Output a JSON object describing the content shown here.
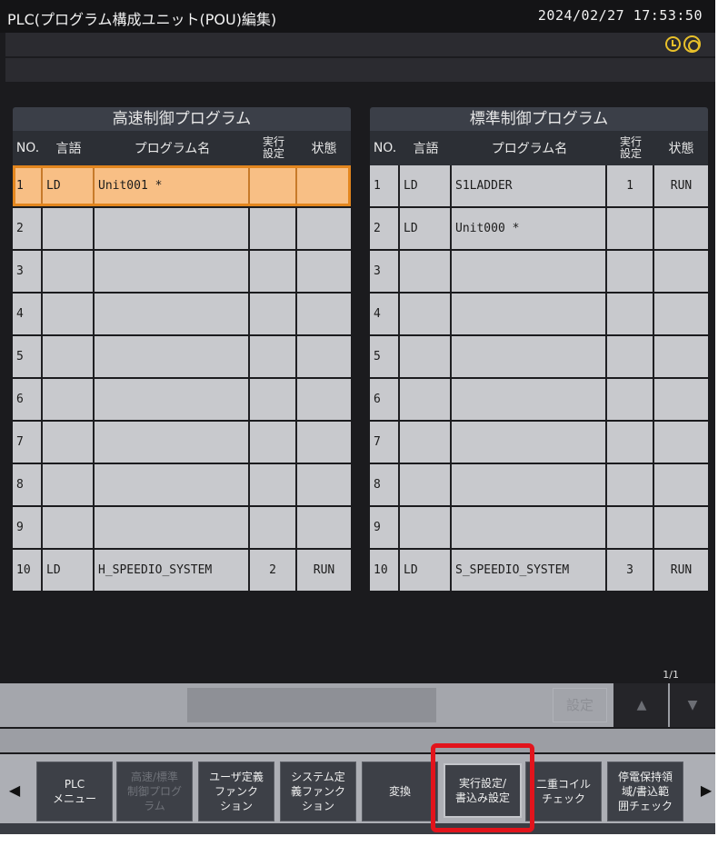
{
  "window": {
    "title": "PLC(プログラム構成ユニット(POU)編集)",
    "datetime": "2024/02/27 17:53:50"
  },
  "status_icons": [
    "clock-icon",
    "sync-icon"
  ],
  "left_table": {
    "caption": "高速制御プログラム",
    "headers": {
      "no": "NO.",
      "lang": "言語",
      "name": "プログラム名",
      "exec": "実行\n設定",
      "state": "状態"
    },
    "rows": [
      {
        "no": "1",
        "lang": "LD",
        "name": "Unit001 *",
        "exec": "",
        "state": ""
      },
      {
        "no": "2",
        "lang": "",
        "name": "",
        "exec": "",
        "state": ""
      },
      {
        "no": "3",
        "lang": "",
        "name": "",
        "exec": "",
        "state": ""
      },
      {
        "no": "4",
        "lang": "",
        "name": "",
        "exec": "",
        "state": ""
      },
      {
        "no": "5",
        "lang": "",
        "name": "",
        "exec": "",
        "state": ""
      },
      {
        "no": "6",
        "lang": "",
        "name": "",
        "exec": "",
        "state": ""
      },
      {
        "no": "7",
        "lang": "",
        "name": "",
        "exec": "",
        "state": ""
      },
      {
        "no": "8",
        "lang": "",
        "name": "",
        "exec": "",
        "state": ""
      },
      {
        "no": "9",
        "lang": "",
        "name": "",
        "exec": "",
        "state": ""
      },
      {
        "no": "10",
        "lang": "LD",
        "name": "H_SPEEDIO_SYSTEM",
        "exec": "2",
        "state": "RUN"
      }
    ]
  },
  "right_table": {
    "caption": "標準制御プログラム",
    "headers": {
      "no": "NO.",
      "lang": "言語",
      "name": "プログラム名",
      "exec": "実行\n設定",
      "state": "状態"
    },
    "rows": [
      {
        "no": "1",
        "lang": "LD",
        "name": "S1LADDER",
        "exec": "1",
        "state": "RUN"
      },
      {
        "no": "2",
        "lang": "LD",
        "name": "Unit000 *",
        "exec": "",
        "state": ""
      },
      {
        "no": "3",
        "lang": "",
        "name": "",
        "exec": "",
        "state": ""
      },
      {
        "no": "4",
        "lang": "",
        "name": "",
        "exec": "",
        "state": ""
      },
      {
        "no": "5",
        "lang": "",
        "name": "",
        "exec": "",
        "state": ""
      },
      {
        "no": "6",
        "lang": "",
        "name": "",
        "exec": "",
        "state": ""
      },
      {
        "no": "7",
        "lang": "",
        "name": "",
        "exec": "",
        "state": ""
      },
      {
        "no": "8",
        "lang": "",
        "name": "",
        "exec": "",
        "state": ""
      },
      {
        "no": "9",
        "lang": "",
        "name": "",
        "exec": "",
        "state": ""
      },
      {
        "no": "10",
        "lang": "LD",
        "name": "S_SPEEDIO_SYSTEM",
        "exec": "3",
        "state": "RUN"
      }
    ]
  },
  "selected_row": {
    "table": "left",
    "no": "1"
  },
  "pager": {
    "page": "1/1",
    "set_label": "設定",
    "up_icon": "▲",
    "down_icon": "▼"
  },
  "function_keys": {
    "prev_icon": "◀",
    "next_icon": "▶",
    "keys": [
      {
        "label": "PLC\nメニュー",
        "enabled": true
      },
      {
        "label": "高速/標準\n制御プログ\nラム",
        "enabled": false
      },
      {
        "label": "ユーザ定義\nファンク\nション",
        "enabled": true
      },
      {
        "label": "システム定\n義ファンク\nション",
        "enabled": true
      },
      {
        "label": "変換",
        "enabled": true
      },
      {
        "label": "実行設定/\n書込み設定",
        "enabled": true,
        "highlighted": true
      },
      {
        "label": "二重コイル\nチェック",
        "enabled": true
      },
      {
        "label": "停電保持領\n域/書込範\n囲チェック",
        "enabled": true
      }
    ]
  },
  "colors": {
    "selected_row_fill": "#f8bf85",
    "selected_row_border": "#e3861e",
    "highlight_box": "#e2141c",
    "status_icon": "#e8c02a"
  }
}
